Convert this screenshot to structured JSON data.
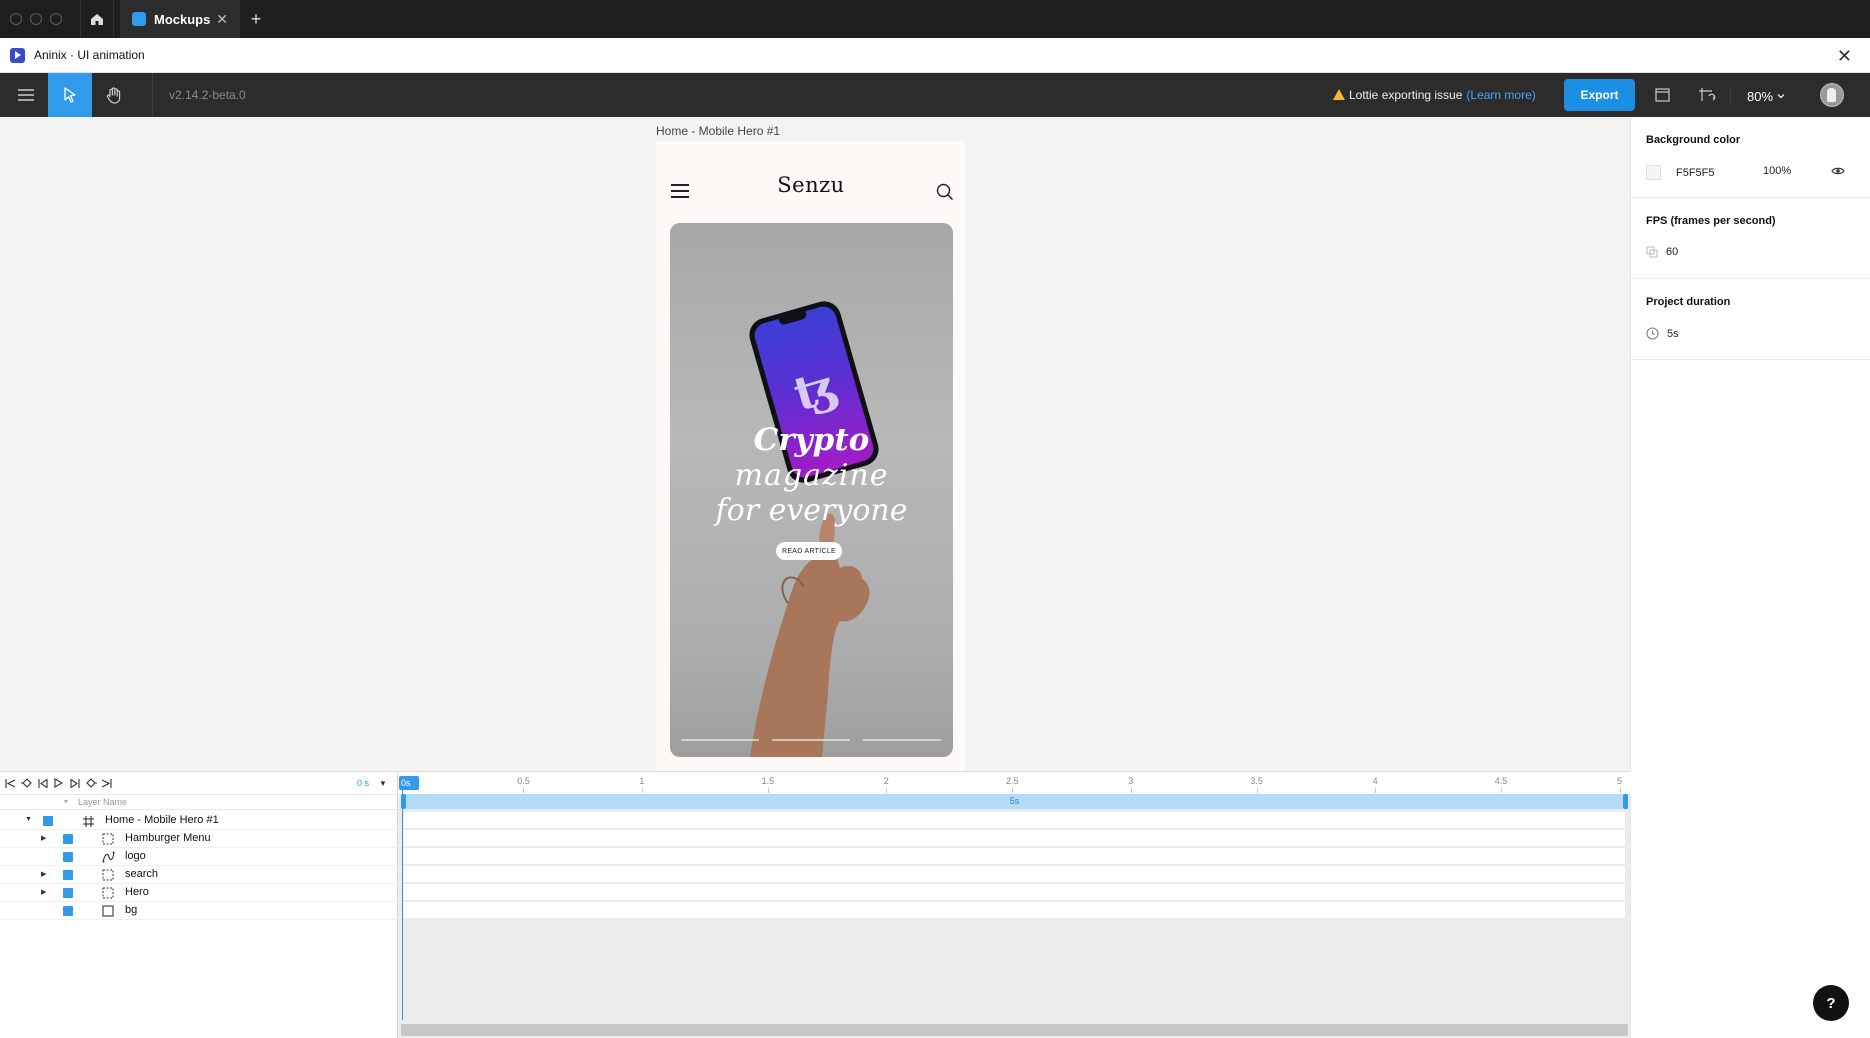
{
  "window": {
    "tab_title": "Mockups",
    "tab_close": "✕",
    "new_tab": "+"
  },
  "plugin": {
    "title": "Aninix · UI animation",
    "close": "✕"
  },
  "toolbar": {
    "version": "v2.14.2-beta.0",
    "warning_text": "Lottie exporting issue",
    "learn_more": "(Learn more)",
    "export_label": "Export",
    "zoom": "80%"
  },
  "canvas": {
    "frame_label": "Home - Mobile Hero #1",
    "background": "#F5F5F5",
    "mockup": {
      "logo": "Senzu",
      "hero_line1": "Crypto",
      "hero_line2": "magazine",
      "hero_line3": "for everyone",
      "button": "READ ARTICLE",
      "device_glyph": "ꜩ"
    }
  },
  "right_panel": {
    "background_color": {
      "title": "Background color",
      "hex": "F5F5F5",
      "opacity": "100%"
    },
    "fps": {
      "title": "FPS (frames per second)",
      "value": "60"
    },
    "duration": {
      "title": "Project duration",
      "value": "5s"
    }
  },
  "timeline": {
    "time_readout": "0 s",
    "layer_header": "Layer Name",
    "playhead": "0s",
    "duration_label": "5s",
    "ticks": [
      "0.5",
      "1",
      "1.5",
      "2",
      "2.5",
      "3",
      "3.5",
      "4",
      "4.5",
      "5"
    ],
    "layers": [
      {
        "name": "Home - Mobile Hero #1",
        "type": "frame",
        "expandable": true,
        "expanded": true,
        "depth": 0
      },
      {
        "name": "Hamburger Menu",
        "type": "group",
        "expandable": true,
        "depth": 1
      },
      {
        "name": "logo",
        "type": "vector",
        "expandable": false,
        "depth": 1
      },
      {
        "name": "search",
        "type": "group",
        "expandable": true,
        "depth": 1
      },
      {
        "name": "Hero",
        "type": "group",
        "expandable": true,
        "depth": 1
      },
      {
        "name": "bg",
        "type": "rectangle",
        "expandable": false,
        "depth": 1
      }
    ]
  },
  "colors": {
    "accent": "#2F9BEA",
    "toolbar_bg": "#2C2C2C",
    "warning": "#F5B82E"
  },
  "help": "?"
}
